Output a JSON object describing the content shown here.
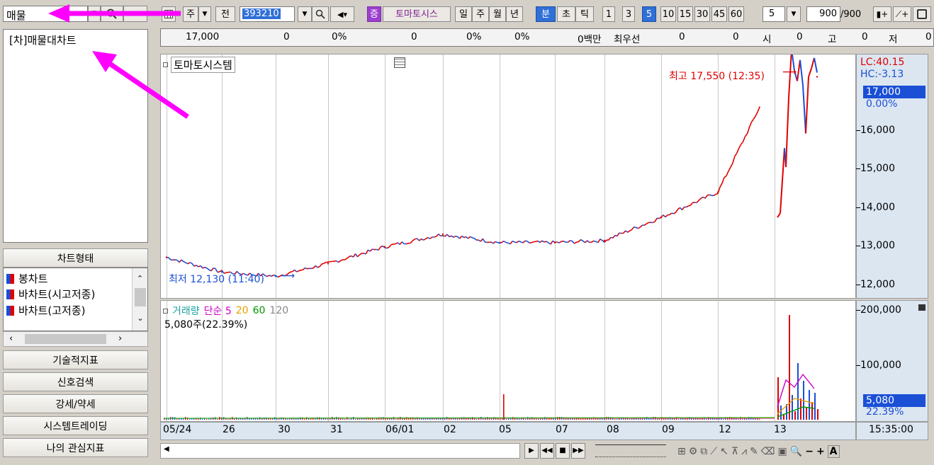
{
  "search": {
    "value": "매물"
  },
  "list": {
    "items": [
      "[차]매물대차트"
    ]
  },
  "chart_types": {
    "header": "차트형태",
    "items": [
      "봉차트",
      "바차트(시고저종)",
      "바차트(고저종)"
    ]
  },
  "left_buttons": [
    "기술적지표",
    "신호검색",
    "강세/약세",
    "시스템트레이딩",
    "나의 관심지표"
  ],
  "toolbar": {
    "market": "주",
    "prefix": "전",
    "code": "393210",
    "badge": "증",
    "name": "토마토시스",
    "periods": [
      "일",
      "주",
      "월",
      "년",
      "분",
      "초",
      "틱"
    ],
    "intervals": [
      "1",
      "3",
      "5",
      "10",
      "15",
      "30",
      "45",
      "60"
    ],
    "selected_period": "분",
    "selected_interval": "5",
    "interval_input": "5",
    "count": "900",
    "count_total": "/900"
  },
  "status": {
    "price": "17,000",
    "v1": "0",
    "p1": "0%",
    "v2": "0",
    "p2": "0%",
    "p3": "0%",
    "amount": "0백만",
    "q_label": "최우선",
    "q1": "0",
    "q2": "0",
    "si_label": "시",
    "si": "0",
    "go_label": "고",
    "go": "0",
    "jeo_label": "저",
    "jeo": "0"
  },
  "price_chart": {
    "title": "토마토시스템",
    "high_annotation": "최고 17,550 (12:35)",
    "low_annotation": "최저 12,130 (11:40)",
    "lc": "LC:40.15",
    "hc": "HC:-3.13",
    "current_price": "17,000",
    "current_change": "0.00%",
    "axis_labels": [
      "16,000",
      "15,000",
      "14,000",
      "13,000",
      "12,000"
    ]
  },
  "volume_chart": {
    "title": "거래량",
    "ma_label": "단순 5",
    "ma": [
      "20",
      "60",
      "120"
    ],
    "info": "5,080주(22.39%)",
    "axis_labels": [
      "200,000",
      "100,000"
    ],
    "current_volume": "5,080",
    "current_pct": "22.39%"
  },
  "date_axis": {
    "labels": [
      "05/24",
      "26",
      "30",
      "31",
      "06/01",
      "02",
      "05",
      "07",
      "08",
      "09",
      "12",
      "13"
    ],
    "time": "15:35:00"
  },
  "colors": {
    "up": "#e00000",
    "down": "#1a4fd6",
    "accent": "#2f6fd6",
    "ma5": "#cc00cc",
    "ma20": "#e8a000",
    "ma60": "#009900",
    "ma120": "#888888",
    "annotation_arrow": "#ff00ff"
  },
  "chart_data": {
    "type": "line",
    "title": "토마토시스템",
    "x": [
      "05/24",
      "26",
      "30",
      "31",
      "06/01",
      "02",
      "05",
      "07",
      "08",
      "09",
      "12",
      "13"
    ],
    "series": [
      {
        "values": [
          12600,
          12250,
          12150,
          12450,
          12850,
          13150,
          12950,
          12950,
          13000,
          13550,
          14150,
          16900
        ]
      }
    ],
    "ylim": [
      11800,
      17600
    ],
    "grid": true
  }
}
